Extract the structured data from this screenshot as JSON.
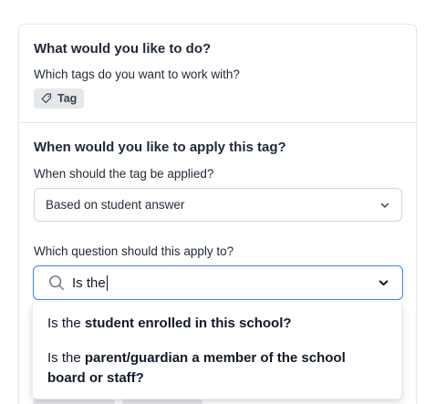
{
  "section1": {
    "title": "What would you like to do?",
    "question": "Which tags do you want to work with?",
    "tag_chip": {
      "label": "Tag",
      "icon": "tag-icon"
    }
  },
  "section2": {
    "title": "When would you like to apply this tag?",
    "when_label": "When should the tag be applied?",
    "when_select": {
      "value": "Based on student answer",
      "icon": "chevron-down-icon"
    },
    "question_label": "Which question should this apply to?",
    "search": {
      "value": "Is the",
      "icon": "search-icon",
      "chevron": "chevron-down-icon"
    }
  },
  "dropdown": {
    "options": [
      {
        "prefix": "Is the ",
        "match": "student enrolled in this school?"
      },
      {
        "prefix": "Is the ",
        "match": "parent/guardian a member of the school board or staff?"
      }
    ]
  },
  "colors": {
    "focus_border": "#3b82f6",
    "chip_bg": "#e5e7eb",
    "border": "#d1d5db",
    "text": "#1f2937"
  }
}
